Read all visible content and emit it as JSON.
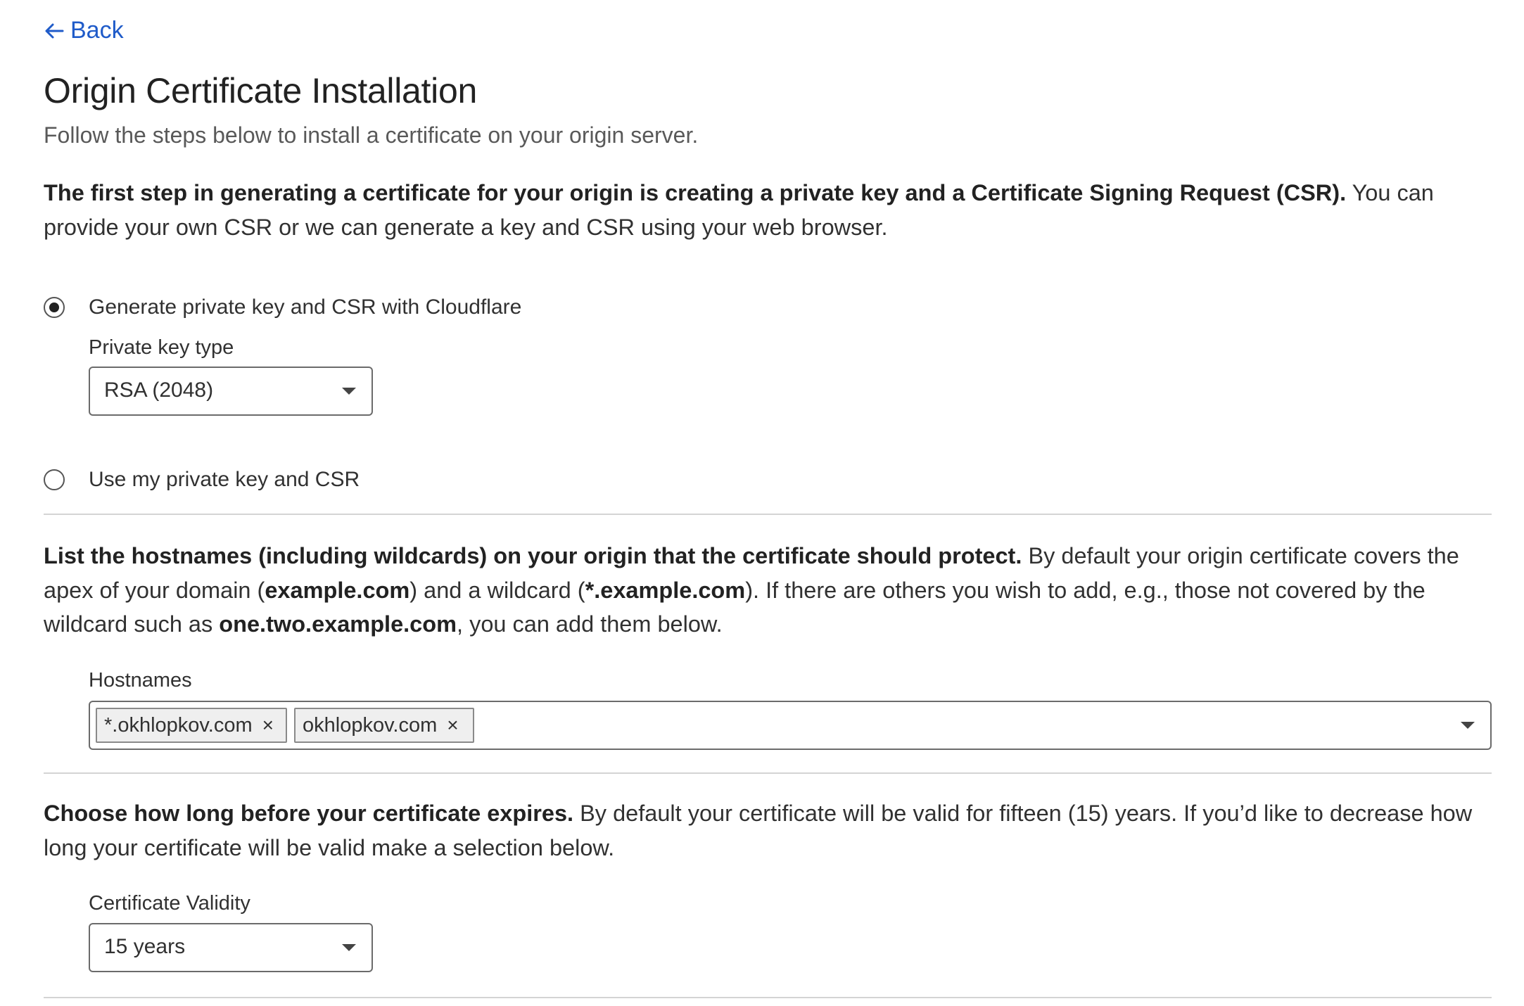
{
  "back": {
    "label": "Back"
  },
  "page": {
    "title": "Origin Certificate Installation",
    "subtitle": "Follow the steps below to install a certificate on your origin server."
  },
  "step_key": {
    "intro_bold": "The first step in generating a certificate for your origin is creating a private key and a Certificate Signing Request (CSR).",
    "intro_rest": " You can provide your own CSR or we can generate a key and CSR using your web browser.",
    "options": [
      {
        "label": "Generate private key and CSR with Cloudflare",
        "selected": true
      },
      {
        "label": "Use my private key and CSR",
        "selected": false
      }
    ],
    "key_type_label": "Private key type",
    "key_type_value": "RSA (2048)"
  },
  "step_hostnames": {
    "intro_bold": "List the hostnames (including wildcards) on your origin that the certificate should protect.",
    "intro_part1": " By default your origin certificate covers the apex of your domain (",
    "apex_example": "example.com",
    "intro_part2": ") and a wildcard (",
    "wildcard_example": "*.example.com",
    "intro_part3": "). If there are others you wish to add, e.g., those not covered by the wildcard such as ",
    "subdomain_example": "one.two.example.com",
    "intro_part4": ", you can add them below.",
    "field_label": "Hostnames",
    "hostnames": [
      "*.okhlopkov.com",
      "okhlopkov.com"
    ],
    "remove_glyph": "×"
  },
  "step_validity": {
    "intro_bold": "Choose how long before your certificate expires.",
    "intro_rest": " By default your certificate will be valid for fifteen (15) years. If you’d like to decrease how long your certificate will be valid make a selection below.",
    "field_label": "Certificate Validity",
    "value": "15 years"
  },
  "colors": {
    "link": "#1f5bc9",
    "text": "#313131",
    "muted": "#595959",
    "border": "#6b6b6b",
    "divider": "#d4d4d4",
    "chip_bg": "#efefef"
  },
  "icons": {
    "back": "arrow-left-icon",
    "dropdown": "caret-down-icon",
    "remove": "close-icon"
  }
}
